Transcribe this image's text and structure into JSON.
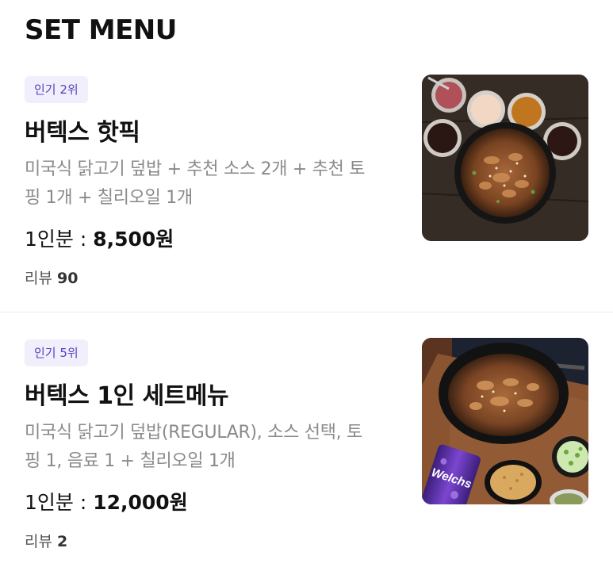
{
  "section": {
    "title": "SET MENU"
  },
  "items": [
    {
      "badge": "인기 2위",
      "name": "버텍스 핫픽",
      "description_line1": "미국식 닭고기 덮밥 + 추천 소스 2개 + 추천 토",
      "description_line2": "핑 1개 + 칠리오일 1개",
      "price_prefix": "1인분 : ",
      "price": "8,500원",
      "review_label": "리뷰",
      "review_count": "90"
    },
    {
      "badge": "인기 5위",
      "name": "버텍스 1인 세트메뉴",
      "description_line1": "미국식 닭고기 덮밥(REGULAR), 소스 선택, 토",
      "description_line2": "핑 1, 음료 1 + 칠리오일 1개",
      "price_prefix": "1인분 : ",
      "price": "12,000원",
      "review_label": "리뷰",
      "review_count": "2",
      "can_label": "Welchs"
    }
  ],
  "colors": {
    "badge_bg": "#f1effb",
    "badge_text": "#5a3fc0",
    "desc_text": "#8a8a8a"
  }
}
